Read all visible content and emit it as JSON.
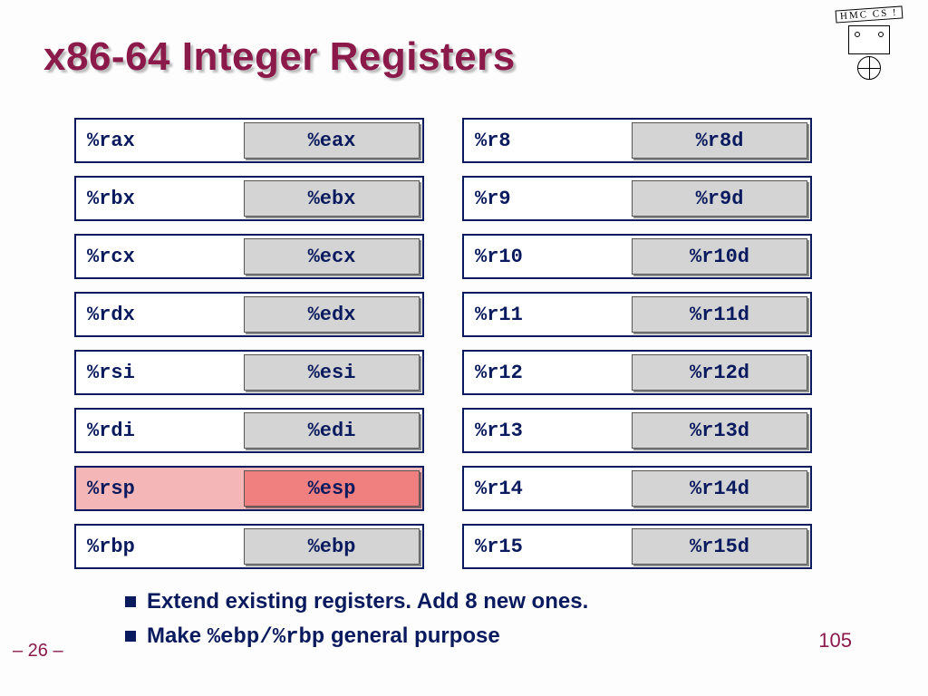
{
  "title": "x86-64 Integer Registers",
  "logo_text": "HMC CS !",
  "columns": {
    "left": [
      {
        "r64": "%rax",
        "r32": "%eax",
        "highlight": false
      },
      {
        "r64": "%rbx",
        "r32": "%ebx",
        "highlight": false
      },
      {
        "r64": "%rcx",
        "r32": "%ecx",
        "highlight": false
      },
      {
        "r64": "%rdx",
        "r32": "%edx",
        "highlight": false
      },
      {
        "r64": "%rsi",
        "r32": "%esi",
        "highlight": false
      },
      {
        "r64": "%rdi",
        "r32": "%edi",
        "highlight": false
      },
      {
        "r64": "%rsp",
        "r32": "%esp",
        "highlight": true
      },
      {
        "r64": "%rbp",
        "r32": "%ebp",
        "highlight": false
      }
    ],
    "right": [
      {
        "r64": "%r8",
        "r32": "%r8d",
        "highlight": false
      },
      {
        "r64": "%r9",
        "r32": "%r9d",
        "highlight": false
      },
      {
        "r64": "%r10",
        "r32": "%r10d",
        "highlight": false
      },
      {
        "r64": "%r11",
        "r32": "%r11d",
        "highlight": false
      },
      {
        "r64": "%r12",
        "r32": "%r12d",
        "highlight": false
      },
      {
        "r64": "%r13",
        "r32": "%r13d",
        "highlight": false
      },
      {
        "r64": "%r14",
        "r32": "%r14d",
        "highlight": false
      },
      {
        "r64": "%r15",
        "r32": "%r15d",
        "highlight": false
      }
    ]
  },
  "bullets": {
    "b1": "Extend existing registers.  Add 8 new ones.",
    "b2_pre": "Make ",
    "b2_code1": "%ebp",
    "b2_sep": "/",
    "b2_code2": "%rbp",
    "b2_post": " general purpose"
  },
  "page_left": "– 26 –",
  "page_right": "105"
}
